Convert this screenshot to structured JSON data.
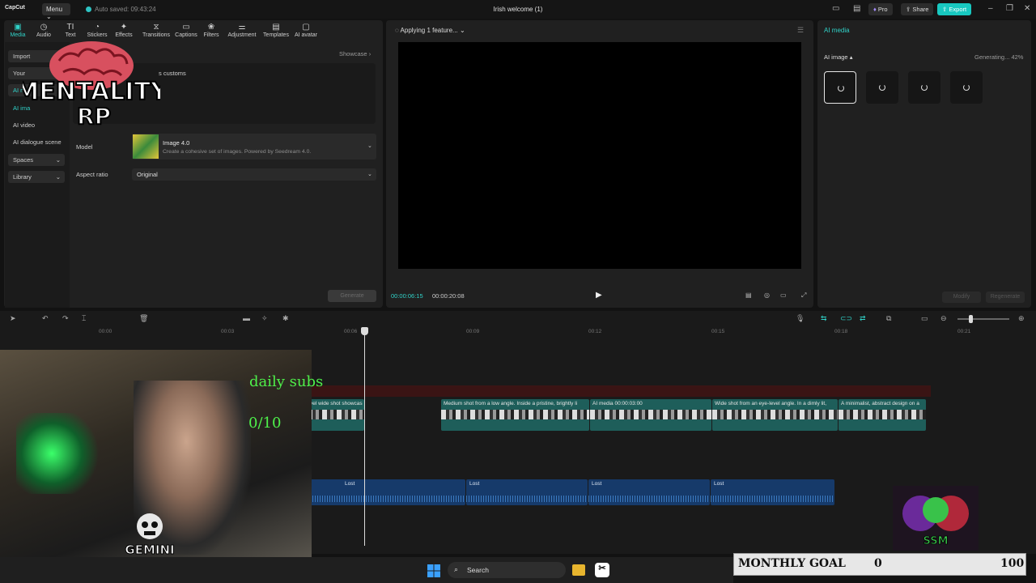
{
  "app": {
    "logo": "CapCut",
    "menu_label": "Menu",
    "autosaved": "Auto saved: 09:43:24",
    "project_title": "Irish welcome (1)",
    "pro_label": "Pro",
    "share_label": "Share",
    "export_label": "Export"
  },
  "toolbar": {
    "items": [
      "Media",
      "Audio",
      "Text",
      "Stickers",
      "Effects",
      "Transitions",
      "Captions",
      "Filters",
      "Adjustment",
      "Templates",
      "AI avatar"
    ],
    "active": "Media"
  },
  "sidenav": {
    "items": [
      "Import",
      "Your",
      "AI m",
      "AI ima",
      "AI video",
      "AI dialogue scene",
      "Spaces",
      "Library"
    ]
  },
  "media_panel": {
    "showcase_label": "Showcase",
    "prompt_text": "s customs",
    "model_label": "Model",
    "model_name": "Image 4.0",
    "model_desc": "Create a cohesive set of images. Powered by Seedream 4.0.",
    "aspect_label": "Aspect ratio",
    "aspect_value": "Original",
    "generate_label": "Generate"
  },
  "overlay_logo": {
    "line1": "MENTALITY",
    "line2": "RP"
  },
  "player": {
    "status": "Applying 1 feature...",
    "time_current": "00:00:06:15",
    "time_total": "00:00:20:08"
  },
  "right_panel": {
    "title": "AI media",
    "section_label": "AI image",
    "status": "Generating... 42%",
    "progress": 0.42,
    "modify_label": "Modify",
    "regenerate_label": "Regenerate"
  },
  "timeline": {
    "ruler": [
      "00:00",
      "00:03",
      "00:06",
      "00:09",
      "00:12",
      "00:15",
      "00:18",
      "00:21"
    ],
    "video_clips": [
      {
        "label": "vel wide shot showcas"
      },
      {
        "label": "Medium shot from a low angle. Inside a pristine, brightly li"
      },
      {
        "label": "AI media   00:00:03:00"
      },
      {
        "label": "Wide shot from an eye-level angle. In a dimly lit,"
      },
      {
        "label": "A minimalist, abstract design on a"
      }
    ],
    "audio_clips": [
      {
        "label": "Lost"
      },
      {
        "label": "Lost"
      },
      {
        "label": "Lost"
      },
      {
        "label": "Lost"
      }
    ]
  },
  "stream_overlay": {
    "daily_subs_label": "daily subs",
    "daily_subs_count": "0/10",
    "gemini_label": "GEMINI",
    "ssm_label": "SSM"
  },
  "goal": {
    "label": "MONTHLY GOAL",
    "current": "0",
    "max": "100"
  },
  "taskbar": {
    "search_label": "Search"
  },
  "colors": {
    "accent": "#30d2c8",
    "export": "#18c8c0",
    "subs_green": "#4ef04a"
  }
}
